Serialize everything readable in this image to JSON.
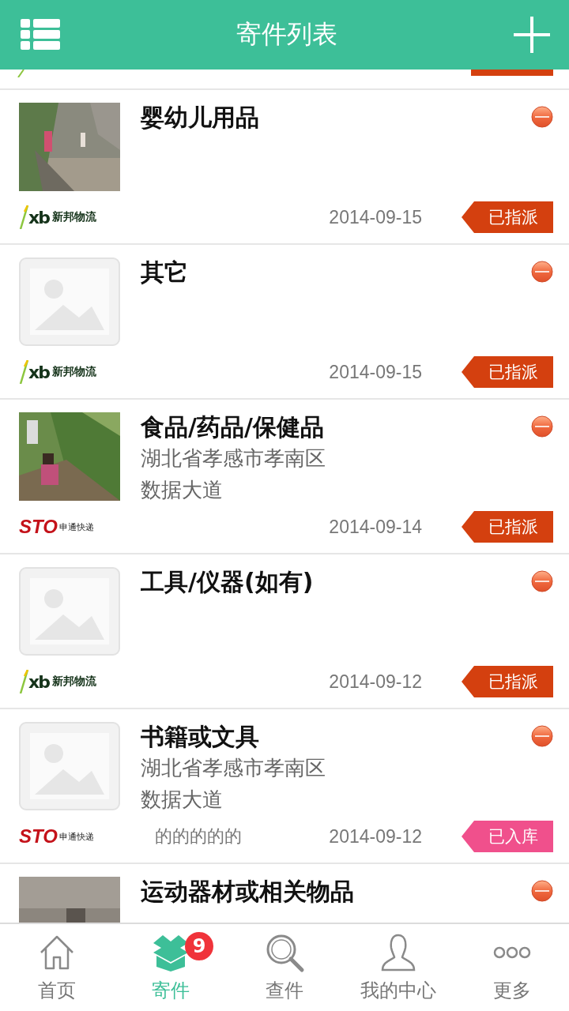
{
  "header": {
    "title": "寄件列表"
  },
  "items": [
    {
      "tag": {
        "color": "#d4400f"
      }
    },
    {
      "title": "婴幼儿用品",
      "carrier": {
        "kind": "xb",
        "mark": "xb",
        "name": "新邦物流"
      },
      "date": "2014-09-15",
      "tag": {
        "text": "已指派",
        "color": "#d4400f"
      }
    },
    {
      "title": "其它",
      "thumb": {
        "kind": "placeholder"
      },
      "carrier": {
        "kind": "xb",
        "mark": "xb",
        "name": "新邦物流"
      },
      "date": "2014-09-15",
      "tag": {
        "text": "已指派",
        "color": "#d4400f"
      }
    },
    {
      "title": "食品/药品/保健品",
      "address": [
        "湖北省孝感市孝南区",
        "数据大道"
      ],
      "carrier": {
        "kind": "sto",
        "mark": "STO",
        "name": "申通快递"
      },
      "date": "2014-09-14",
      "tag": {
        "text": "已指派",
        "color": "#d4400f"
      }
    },
    {
      "title": "工具/仪器(如有)",
      "thumb": {
        "kind": "placeholder"
      },
      "carrier": {
        "kind": "xb",
        "mark": "xb",
        "name": "新邦物流"
      },
      "date": "2014-09-12",
      "tag": {
        "text": "已指派",
        "color": "#d4400f"
      }
    },
    {
      "title": "书籍或文具",
      "thumb": {
        "kind": "placeholder"
      },
      "address": [
        "湖北省孝感市孝南区",
        "数据大道"
      ],
      "carrier": {
        "kind": "sto",
        "mark": "STO",
        "name": "申通快递"
      },
      "note": "的的的的的",
      "date": "2014-09-12",
      "tag": {
        "text": "已入库",
        "color": "#f0508c"
      }
    },
    {
      "title": "运动器材或相关物品"
    }
  ],
  "nav": [
    {
      "kind": "home",
      "label": "首页",
      "selected": false
    },
    {
      "kind": "box",
      "label": "寄件",
      "selected": true,
      "badge": "9"
    },
    {
      "kind": "search",
      "label": "查件",
      "selected": false
    },
    {
      "kind": "person",
      "label": "我的中心",
      "selected": false
    },
    {
      "kind": "more",
      "label": "更多",
      "selected": false
    }
  ]
}
